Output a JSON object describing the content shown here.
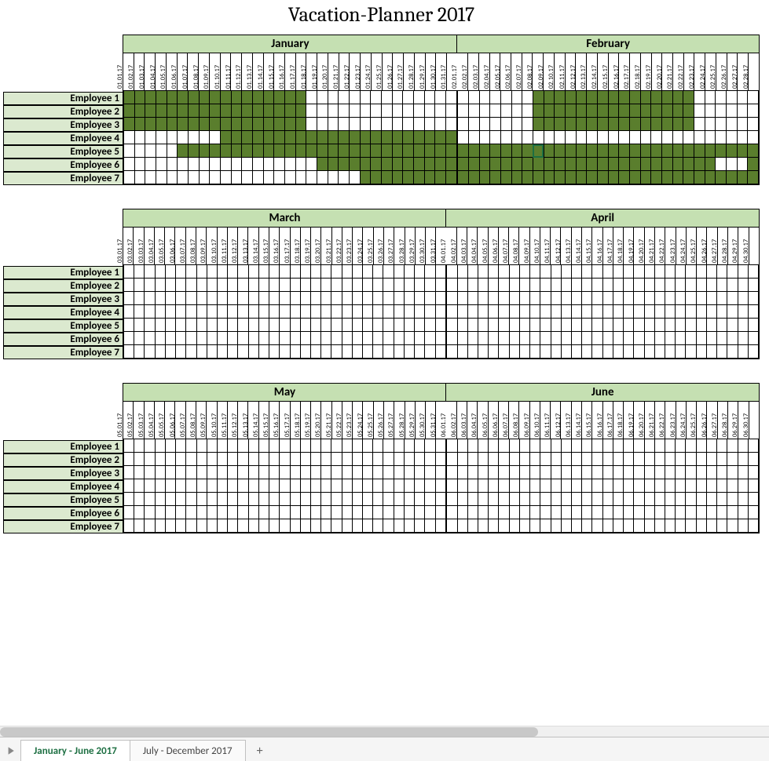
{
  "title": "Vacation-Planner 2017",
  "tabs": {
    "active": "January - June 2017",
    "inactive": "July - December 2017"
  },
  "employees": [
    "Employee 1",
    "Employee 2",
    "Employee 3",
    "Employee 4",
    "Employee 5",
    "Employee 6",
    "Employee 7"
  ],
  "pairs": [
    {
      "months": [
        {
          "name": "January",
          "num": "01",
          "days": 31
        },
        {
          "name": "February",
          "num": "02",
          "days": 28
        }
      ]
    },
    {
      "months": [
        {
          "name": "March",
          "num": "03",
          "days": 31
        },
        {
          "name": "April",
          "num": "04",
          "days": 30
        }
      ]
    },
    {
      "months": [
        {
          "name": "May",
          "num": "05",
          "days": 31
        },
        {
          "name": "June",
          "num": "06",
          "days": 30
        }
      ]
    }
  ],
  "vacations": {
    "01": {
      "Employee 1": [
        1,
        2,
        3,
        4,
        5,
        6,
        7,
        8,
        9,
        10,
        11,
        12,
        13,
        14,
        15,
        16,
        17
      ],
      "Employee 2": [
        1,
        2,
        3,
        4,
        5,
        6,
        7,
        8,
        9,
        10,
        11,
        12,
        13,
        14,
        15,
        16,
        17
      ],
      "Employee 3": [
        1,
        2,
        3,
        4,
        5,
        6,
        7,
        8,
        9,
        10,
        11,
        12,
        13,
        14,
        15,
        16,
        17
      ],
      "Employee 4": [
        10,
        11,
        12,
        13,
        14,
        15,
        16,
        17,
        18,
        19,
        20,
        21,
        22,
        23,
        24,
        25,
        26,
        27,
        28,
        29,
        30,
        31
      ],
      "Employee 5": [
        6,
        7,
        8,
        9,
        10,
        11,
        12,
        13,
        14,
        15,
        16,
        17,
        18,
        19,
        20,
        21,
        22,
        23,
        24,
        25,
        26,
        27,
        28,
        29,
        30,
        31
      ],
      "Employee 6": [
        19,
        20,
        21,
        22,
        23,
        24,
        25,
        26,
        27,
        28,
        29,
        30,
        31
      ],
      "Employee 7": [
        23,
        24,
        25,
        26,
        27,
        28,
        29,
        30,
        31
      ]
    },
    "02": {
      "Employee 1": [
        8,
        9,
        10,
        11,
        12,
        13,
        14,
        15,
        16,
        17,
        18,
        19,
        20,
        21,
        22
      ],
      "Employee 2": [
        8,
        9,
        10,
        11,
        12,
        13,
        14,
        15,
        16,
        17,
        18,
        19,
        20,
        21,
        22
      ],
      "Employee 3": [
        8,
        9,
        10,
        11,
        12,
        13,
        14,
        15,
        16,
        17,
        18,
        19,
        20,
        21,
        22
      ],
      "Employee 5": [
        1,
        2,
        3,
        4,
        5,
        6,
        7,
        8,
        9,
        10,
        11,
        12,
        13,
        14,
        15,
        16,
        17,
        18,
        19,
        20,
        21,
        22,
        23,
        24,
        25,
        26,
        27,
        28
      ],
      "Employee 6": [
        1,
        2,
        3,
        4,
        5,
        6,
        7,
        8,
        9,
        10,
        11,
        12,
        13,
        14,
        15,
        16,
        17,
        18,
        19,
        20,
        21,
        22,
        23,
        24,
        28
      ],
      "Employee 7": [
        1,
        2,
        3,
        4,
        5,
        6,
        7,
        8,
        9,
        10,
        11,
        12,
        13,
        14,
        15,
        16,
        17,
        18,
        19,
        20,
        21,
        22,
        23,
        24,
        25,
        26,
        27,
        28
      ]
    }
  },
  "selected": {
    "month": "02",
    "employee": "Employee 5",
    "day": 8
  },
  "year_suffix": "17",
  "chart_data": {
    "type": "table",
    "title": "Vacation-Planner 2017",
    "row_labels": [
      "Employee 1",
      "Employee 2",
      "Employee 3",
      "Employee 4",
      "Employee 5",
      "Employee 6",
      "Employee 7"
    ],
    "columns": "daily dates 01.01.17 through 06.30.17",
    "legend": {
      "filled": "vacation day",
      "blank": "working day"
    },
    "january_filled": {
      "Employee 1": "01.01–01.17",
      "Employee 2": "01.01–01.17",
      "Employee 3": "01.01–01.17",
      "Employee 4": "01.10–01.31",
      "Employee 5": "01.06–01.31",
      "Employee 6": "01.19–01.31",
      "Employee 7": "01.23–01.31"
    },
    "february_filled": {
      "Employee 1": "02.08–02.22",
      "Employee 2": "02.08–02.22",
      "Employee 3": "02.08–02.22",
      "Employee 4": "none",
      "Employee 5": "02.01–02.28",
      "Employee 6": "02.01–02.24, 02.28",
      "Employee 7": "02.01–02.28"
    },
    "march_to_june_filled": "none"
  }
}
